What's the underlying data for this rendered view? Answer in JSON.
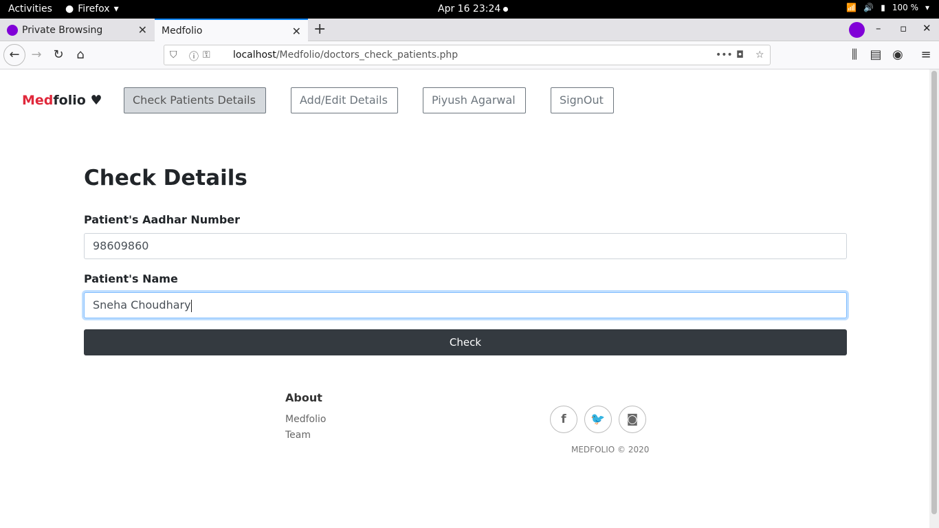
{
  "os_bar": {
    "activities": "Activities",
    "app_name": "Firefox",
    "clock": "Apr 16  23:24",
    "battery": "100 %"
  },
  "browser": {
    "tabs": [
      {
        "title": "Private Browsing"
      },
      {
        "title": "Medfolio"
      }
    ],
    "url_host": "localhost",
    "url_path": "/Medfolio/doctors_check_patients.php"
  },
  "site": {
    "logo_red": "Med",
    "logo_dark": "folio",
    "nav": {
      "check": "Check Patients Details",
      "add_edit": "Add/Edit Details",
      "user": "Piyush Agarwal",
      "signout": "SignOut"
    },
    "heading": "Check Details",
    "form": {
      "aadhar_label": "Patient's Aadhar Number",
      "aadhar_value": "98609860",
      "name_label": "Patient's Name",
      "name_value": "Sneha Choudhary",
      "submit": "Check"
    },
    "footer": {
      "about_heading": "About",
      "links": [
        "Medfolio",
        "Team"
      ],
      "copyright": "MEDFOLIO © 2020"
    }
  }
}
